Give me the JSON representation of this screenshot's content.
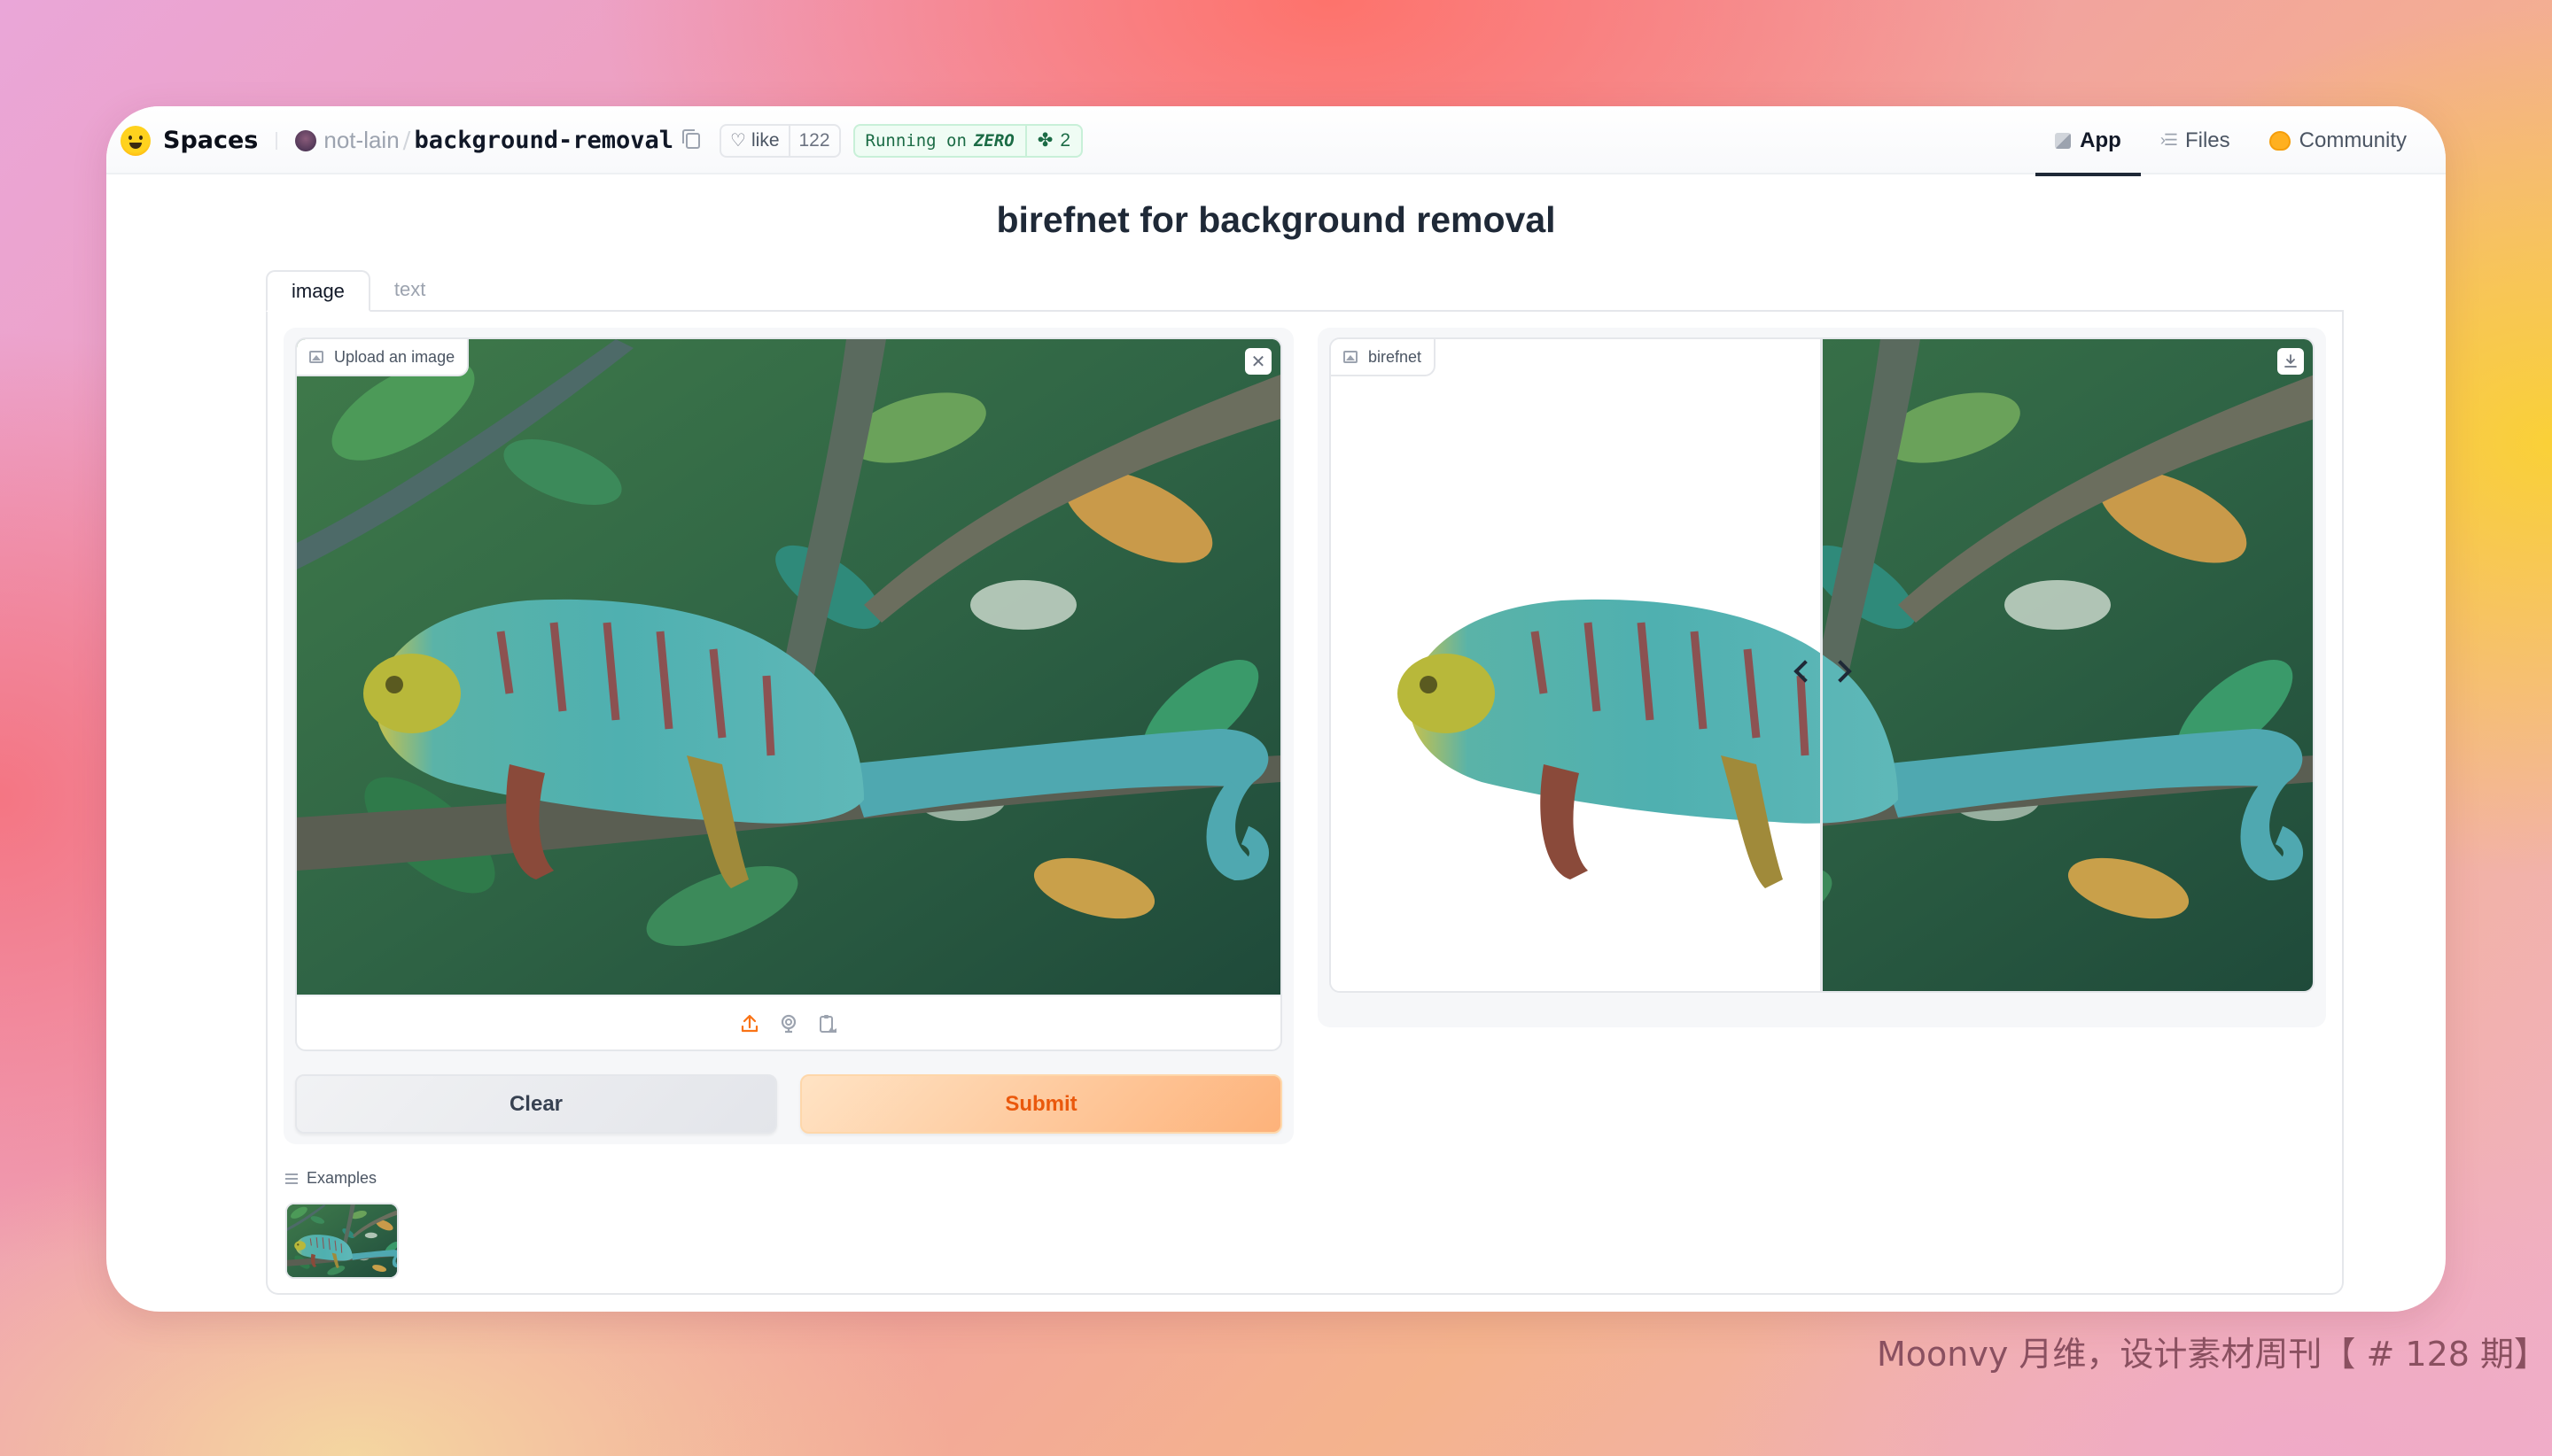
{
  "header": {
    "brand": "Spaces",
    "owner": "not-lain",
    "separator": "/",
    "repo": "background-removal",
    "like_label": "like",
    "like_count": "122",
    "status_prefix": "Running on",
    "status_hardware": "ZERO",
    "replicas": "2",
    "nav": [
      {
        "label": "App",
        "icon": "cube-icon",
        "active": true
      },
      {
        "label": "Files",
        "icon": "files-icon",
        "active": false
      },
      {
        "label": "Community",
        "icon": "community-icon",
        "active": false
      }
    ]
  },
  "app": {
    "title": "birefnet for background removal",
    "tabs": [
      {
        "label": "image",
        "active": true
      },
      {
        "label": "text",
        "active": false
      }
    ],
    "input": {
      "label": "Upload an image",
      "clear_icon": "close-icon",
      "toolbar_icons": [
        "upload-icon",
        "webcam-icon",
        "clipboard-icon"
      ]
    },
    "output": {
      "label": "birefnet",
      "download_icon": "download-icon",
      "slider_position": 0.5
    },
    "buttons": {
      "clear": "Clear",
      "submit": "Submit"
    },
    "examples": {
      "label": "Examples",
      "count": 1
    }
  },
  "colors": {
    "accent": "#ea580c",
    "submit_bg_start": "#ffe3c4",
    "submit_bg_end": "#fdb27a",
    "running_green": "#1b6b45"
  },
  "watermark": "Moonvy 月维，设计素材周刊【 # 128 期】"
}
